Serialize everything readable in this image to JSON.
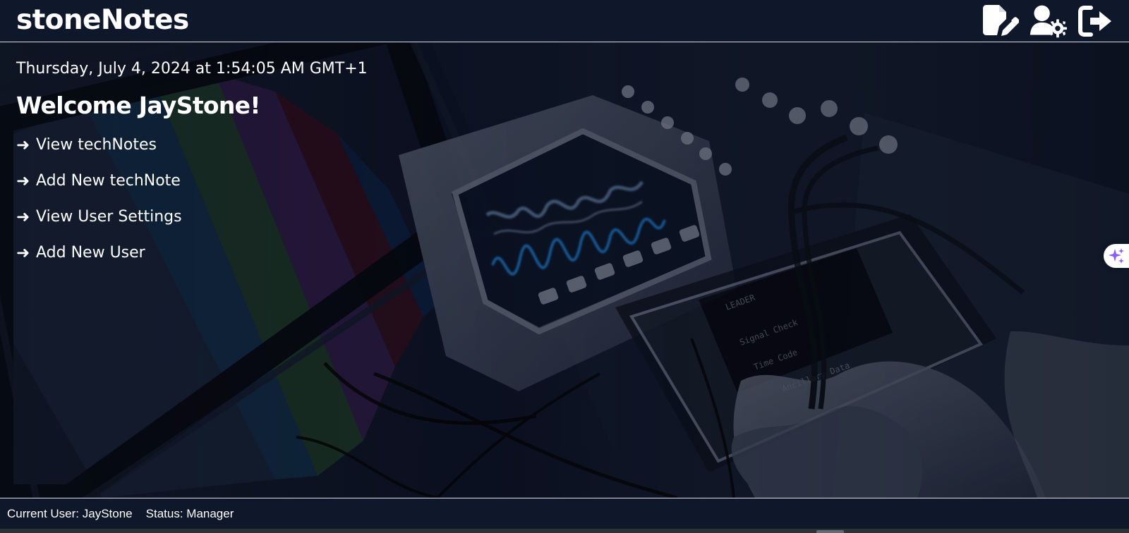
{
  "app": {
    "title": "stoneNotes"
  },
  "header": {
    "actions": [
      {
        "name": "new-note-icon",
        "icon": "file-pen-icon"
      },
      {
        "name": "user-settings-icon",
        "icon": "user-gear-icon"
      },
      {
        "name": "logout-icon",
        "icon": "sign-out-icon"
      }
    ]
  },
  "main": {
    "datetime": "Thursday, July 4, 2024 at 1:54:05 AM GMT+1",
    "welcome": "Welcome JayStone!",
    "arrow": "➜",
    "links": [
      {
        "label": "View techNotes"
      },
      {
        "label": "Add New techNote"
      },
      {
        "label": "View User Settings"
      },
      {
        "label": "Add New User"
      }
    ]
  },
  "footer": {
    "current_user": "Current User: JayStone",
    "status": "Status: Manager"
  },
  "colors": {
    "header_bg": "#0f172a",
    "text": "#ffffff",
    "widget_accent": "#8b5cf6"
  },
  "side_widget": {
    "icon": "sparkle-icon"
  }
}
